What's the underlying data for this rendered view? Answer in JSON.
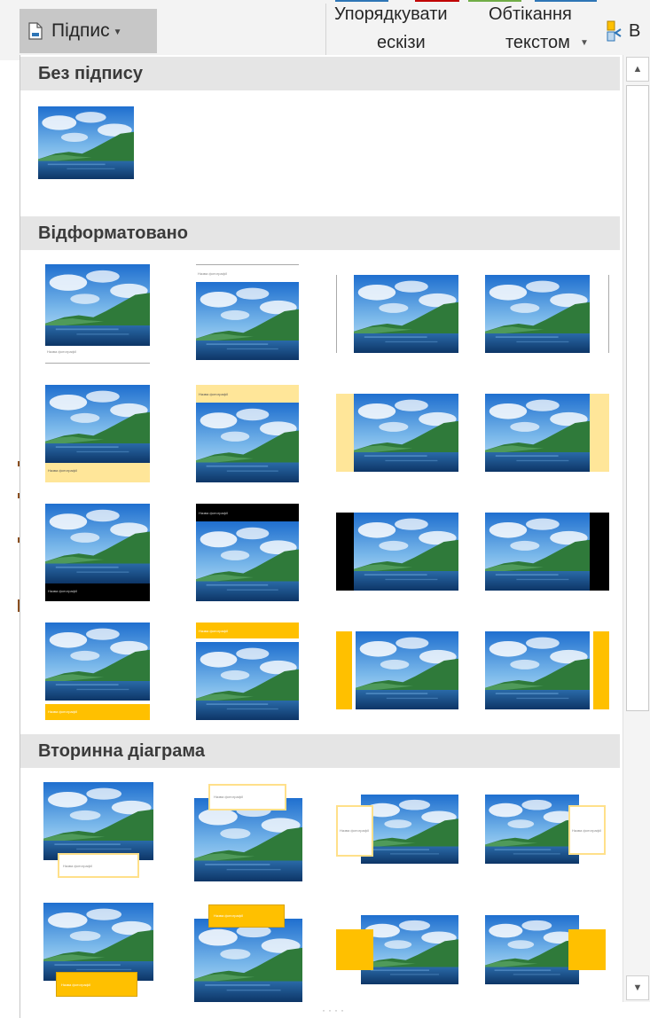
{
  "ribbon": {
    "caption_button": "Підпис",
    "arrange_line1": "Упорядкувати",
    "arrange_line2": "ескізи",
    "wrap_line1": "Обтікання",
    "wrap_line2": "текстом",
    "bring_label": "В",
    "strip_colors": [
      "#2e75b6",
      "#c00000",
      "#70ad47",
      "#2e75b6"
    ]
  },
  "gallery": {
    "sections": [
      {
        "title": "Без підпису"
      },
      {
        "title": "Відформатовано"
      },
      {
        "title": "Вторинна діаграма"
      }
    ]
  },
  "caption_sample": "Назва фотографії",
  "colors": {
    "sky_top": "#1f6fcf",
    "sky_bottom": "#9fd0f2",
    "mountain": "#2f7a3a",
    "water": "#15447a",
    "accent_light": "#ffe699",
    "accent_dark": "#000000",
    "accent_gold": "#ffc000"
  },
  "icons": [
    "document-caption-icon",
    "dropdown-arrow-icon",
    "bring-forward-icon",
    "scroll-up-arrow-icon",
    "scroll-down-arrow-icon",
    "resize-grip-icon"
  ]
}
